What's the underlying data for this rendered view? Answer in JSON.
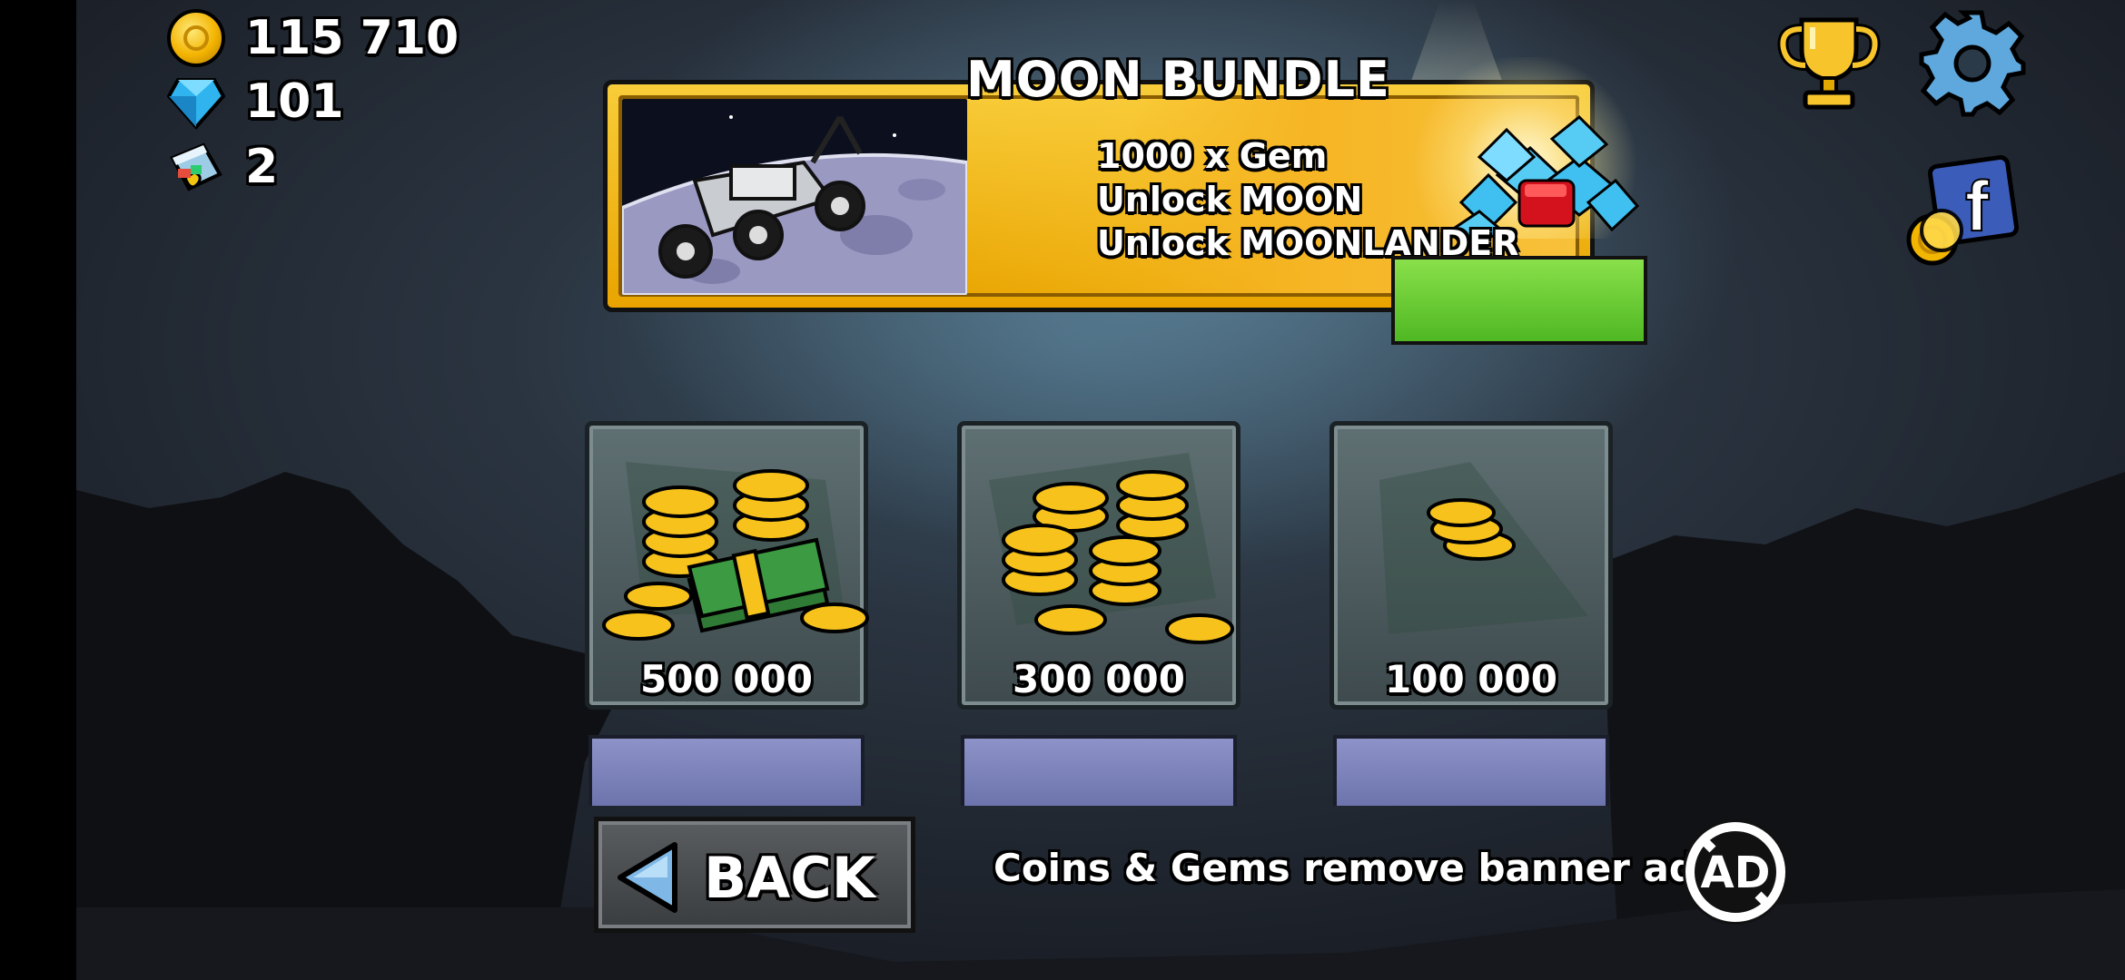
{
  "hud": {
    "coins": "115 710",
    "gems": "101",
    "fuel_boosts": "2"
  },
  "icons": {
    "coin": "coin-icon",
    "gem": "gem-icon",
    "paint": "paint-bucket-icon",
    "trophy": "trophy-icon",
    "settings": "gear-icon",
    "facebook": "facebook-icon",
    "back": "back-arrow-icon",
    "no_ads": "no-ads-icon"
  },
  "bundle": {
    "title": "MOON BUNDLE",
    "lines": [
      "1000 x Gem",
      "Unlock MOON",
      "Unlock MOONLANDER"
    ]
  },
  "packs": [
    {
      "amount": "500 000"
    },
    {
      "amount": "300 000"
    },
    {
      "amount": "100 000"
    }
  ],
  "footer": {
    "back_label": "BACK",
    "note": "Coins & Gems remove banner ads!",
    "no_ads_label": "AD"
  },
  "colors": {
    "bundle_gold": "#f4b31a",
    "buy_green": "#5cc22a",
    "pack_button": "#7c82bb"
  }
}
